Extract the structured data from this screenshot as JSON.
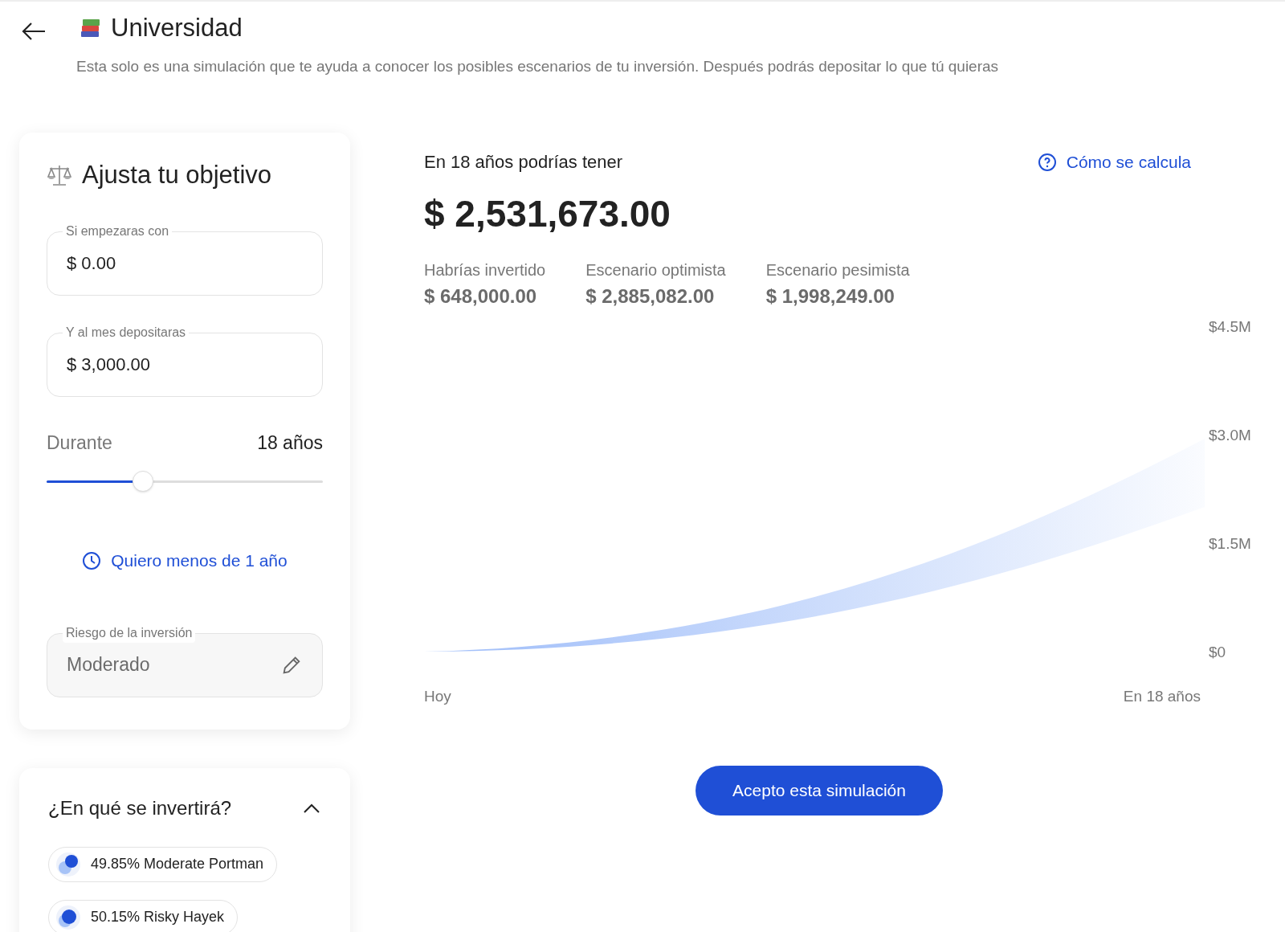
{
  "header": {
    "title": "Universidad",
    "subtitle": "Esta solo es una simulación que te ayuda a conocer los posibles escenarios de tu inversión. Después podrás depositar lo que tú quieras"
  },
  "goal_card": {
    "title": "Ajusta tu objetivo",
    "fields": [
      {
        "label": "Si empezaras con",
        "value": "$ 0.00"
      },
      {
        "label": "Y al mes depositaras",
        "value": "$ 3,000.00"
      }
    ],
    "duration": {
      "label": "Durante",
      "value": "18 años",
      "level": 0.35
    },
    "short_term_link": "Quiero menos de 1 año",
    "risk": {
      "label": "Riesgo de la inversión",
      "value": "Moderado"
    }
  },
  "allocation": {
    "title": "¿En qué se invertirá?",
    "expanded": true,
    "items": [
      {
        "label": "49.85% Moderate Portman"
      },
      {
        "label": "50.15% Risky Hayek"
      }
    ]
  },
  "result": {
    "heading": "En 18 años podrías tener",
    "help_link": "Cómo se calcula",
    "total": "$ 2,531,673.00",
    "stats": [
      {
        "label": "Habrías invertido",
        "value": "$ 648,000.00"
      },
      {
        "label": "Escenario optimista",
        "value": "$ 2,885,082.00"
      },
      {
        "label": "Escenario pesimista",
        "value": "$ 1,998,249.00"
      }
    ],
    "growth_chart": {
      "y_labels": [
        "$4.5M",
        "$3.0M",
        "$1.5M",
        "$0"
      ],
      "x_labels": [
        "Hoy",
        "En 18 años"
      ]
    },
    "accept_button": "Acepto esta simulación"
  }
}
